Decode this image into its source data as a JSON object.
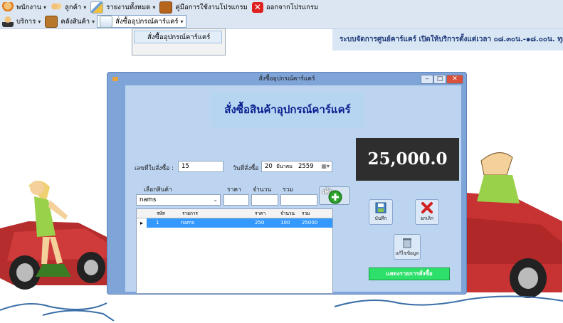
{
  "menu_primary": [
    {
      "label": "พนักงาน",
      "icon": "employee-icon",
      "has_submenu": true
    },
    {
      "label": "ลูกค้า",
      "icon": "customers-icon",
      "has_submenu": true
    },
    {
      "label": "รายงานทั้งหมด",
      "icon": "report-icon",
      "has_submenu": true
    },
    {
      "label": "คู่มือการใช้งานโปรแกรม",
      "icon": "manual-book-icon",
      "has_submenu": false
    },
    {
      "label": "ออกจากโปรแกรม",
      "icon": "exit-x-icon",
      "has_submenu": false
    }
  ],
  "menu_secondary": [
    {
      "label": "บริการ",
      "icon": "service-person-icon",
      "has_submenu": true
    },
    {
      "label": "คลังสินค้า",
      "icon": "warehouse-box-icon",
      "has_submenu": true
    },
    {
      "label": "สั่งซื้ออุปกรณ์คาร์แคร์",
      "icon": "order-document-icon",
      "has_submenu": true,
      "open": true
    }
  ],
  "dropdown": {
    "item": "สั่งซื้ออุปกรณ์คาร์แคร์"
  },
  "banner_text": "ระบบจัดการศูนย์คาร์แคร์ เปิดให้บริการตั้งแต่เวลา ๐๘.๓๐น.-๑๘.๐๐น. ทุก",
  "window": {
    "title": "สั่งซื้ออุปกรณ์คาร์แคร์",
    "header": "สั่งซื้อสินค้าอุปกรณ์คาร์แคร์",
    "total_display": "25,000.0",
    "order_no_label": "เลขที่ใบสั่งซื้อ :",
    "order_no_value": "15",
    "order_date_label": "วันที่สั่งซื้อ :",
    "order_date": {
      "day": "20",
      "month": "มีนาคม",
      "year": "2559"
    },
    "product_label": "เลือกสินค้า",
    "price_label": "ราคา",
    "qty_label": "จำนวน",
    "sum_label": "รวม",
    "product_selected": "nams",
    "add_button_label": "เพิ่ม",
    "save_button_label": "บันทึก",
    "cancel_button_label": "ยกเลิก",
    "edit_button_label": "แก้ไขข้อมูล",
    "report_button_label": "แสดงรายการสั่งซื้อ",
    "grid": {
      "columns": [
        "รหัส",
        "รายการ",
        "ราคา",
        "จำนวน",
        "รวม"
      ],
      "rows": [
        [
          "1",
          "nams",
          "250",
          "100",
          "25000"
        ]
      ]
    }
  },
  "colors": {
    "accent": "#3399ff",
    "report_button": "#2de06a",
    "total_bg": "#2e2e2e",
    "window_frame": "#7fa4d8"
  }
}
